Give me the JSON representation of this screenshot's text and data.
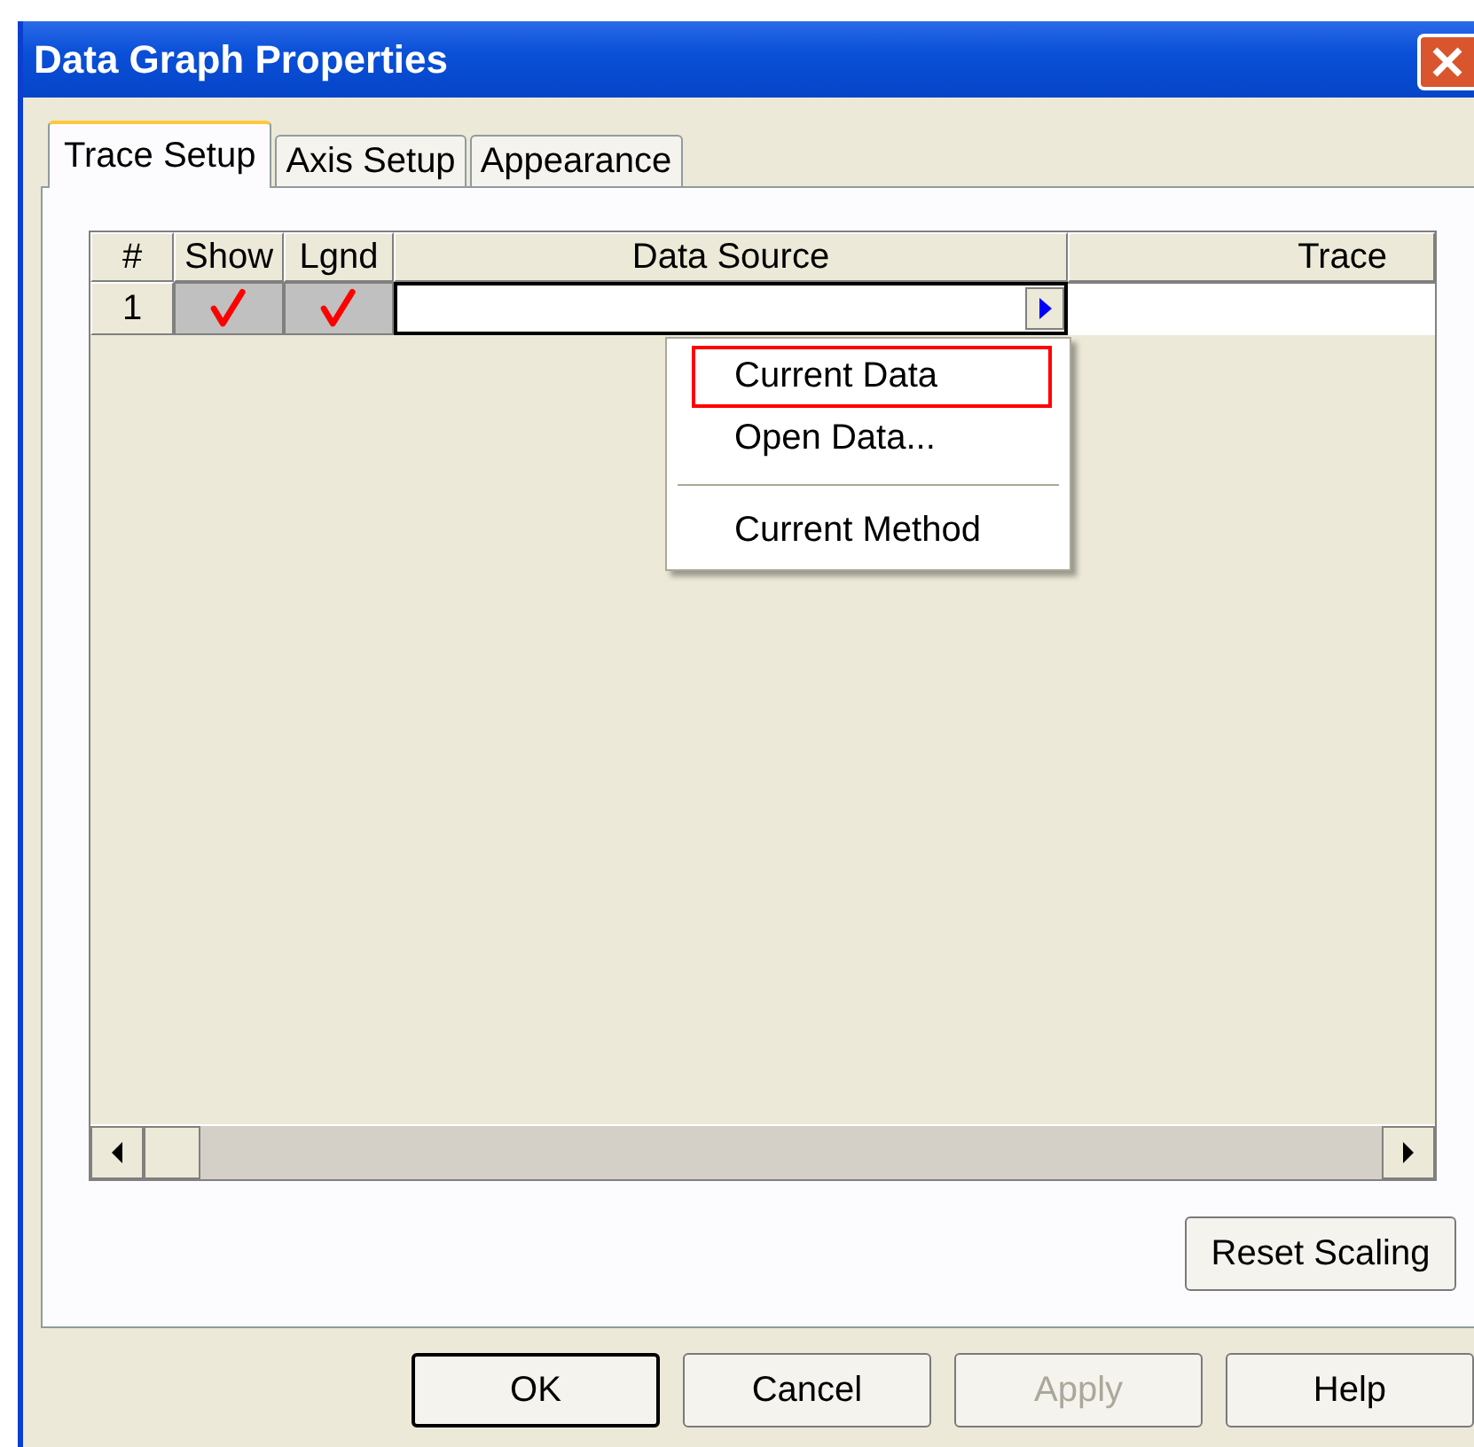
{
  "window": {
    "title": "Data Graph Properties"
  },
  "tabs": [
    {
      "label": "Trace Setup",
      "selected": true
    },
    {
      "label": "Axis Setup",
      "selected": false
    },
    {
      "label": "Appearance",
      "selected": false
    }
  ],
  "table": {
    "columns": [
      "#",
      "Show",
      "Lgnd",
      "Data Source",
      "Trace"
    ],
    "rows": [
      {
        "number": "1",
        "show": {
          "checked": true
        },
        "legend": {
          "checked": true
        },
        "data_source": "",
        "trace": ""
      }
    ]
  },
  "menu": {
    "items": [
      {
        "kind": "item",
        "label": "Current Data",
        "selected": true
      },
      {
        "kind": "item",
        "label": "Open Data...",
        "selected": false
      },
      {
        "kind": "separator"
      },
      {
        "kind": "item",
        "label": "Current Method",
        "selected": false
      }
    ]
  },
  "reset_button": {
    "label": "Reset Scaling",
    "disabled": false
  },
  "buttons": [
    {
      "label": "OK",
      "disabled": false,
      "default": true
    },
    {
      "label": "Cancel",
      "disabled": false,
      "default": false
    },
    {
      "label": "Apply",
      "disabled": true,
      "default": false
    },
    {
      "label": "Help",
      "disabled": false,
      "default": false
    }
  ]
}
